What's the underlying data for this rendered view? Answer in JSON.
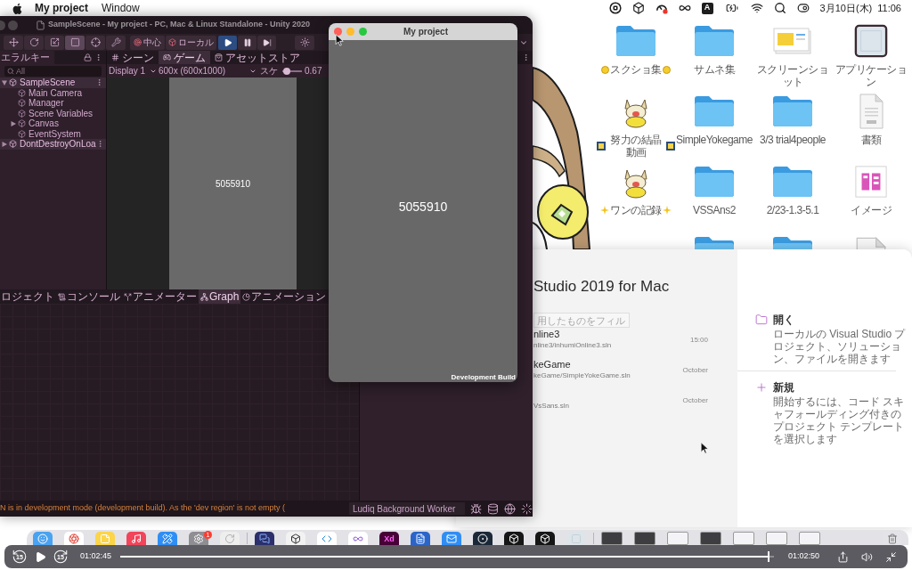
{
  "menubar": {
    "app_name": "My project",
    "menus": [
      "Window"
    ],
    "input_source": "A",
    "date": "3月10日(木)",
    "time": "11:06"
  },
  "desktop_icons": [
    {
      "kind": "folder",
      "label": "スクショ集",
      "decoration": {
        "kind": "coin"
      }
    },
    {
      "kind": "folder",
      "label": "サムネ集"
    },
    {
      "kind": "screenshot",
      "label": "スクリーンショット"
    },
    {
      "kind": "app_folder",
      "label": "アプリケーション"
    },
    {
      "kind": "sticker",
      "label": "努力の結晶動画",
      "decoration": {
        "kind": "picture"
      }
    },
    {
      "kind": "folder",
      "label": "SimpleYokegame"
    },
    {
      "kind": "folder",
      "label": "3/3 trial4people"
    },
    {
      "kind": "document",
      "label": "書類"
    },
    {
      "kind": "sticker",
      "label": "ワンの記録",
      "decoration": {
        "kind": "sparkle"
      }
    },
    {
      "kind": "folder",
      "label": "VSSAns2"
    },
    {
      "kind": "folder",
      "label": "2/23-1.3-5.1"
    },
    {
      "kind": "image",
      "label": "イメージ"
    },
    {
      "kind": "folder"
    },
    {
      "kind": "folder"
    },
    {
      "kind": "document"
    }
  ],
  "unity": {
    "title": "SampleScene - My project - PC, Mac & Linux Standalone - Unity 2020",
    "tools": [
      {
        "kind": "move",
        "selected": false
      },
      {
        "kind": "rotate",
        "selected": false
      },
      {
        "kind": "scale",
        "selected": false
      },
      {
        "kind": "rect",
        "selected": true
      },
      {
        "kind": "transform",
        "selected": false
      },
      {
        "kind": "custom",
        "selected": false
      }
    ],
    "pivot_button": "中心",
    "space_button": "ローカル",
    "playback": [
      {
        "kind": "play",
        "on": true
      },
      {
        "kind": "pause",
        "on": false
      },
      {
        "kind": "step",
        "on": false
      }
    ],
    "hierarchy": {
      "tab": "エラルキー",
      "search_placeholder": "All",
      "items": [
        {
          "label": "SampleScene",
          "kind": "scene",
          "expanded": true,
          "children": [
            {
              "label": "Main Camera",
              "kind": "object"
            },
            {
              "label": "Manager",
              "kind": "object"
            },
            {
              "label": "Scene Variables",
              "kind": "object"
            },
            {
              "label": "Canvas",
              "kind": "object",
              "expanded": false
            },
            {
              "label": "EventSystem",
              "kind": "object"
            }
          ]
        },
        {
          "label": "DontDestroyOnLoa",
          "kind": "scene",
          "expanded": false
        }
      ]
    },
    "center_tabs": [
      {
        "label": "シーン",
        "kind": "scene",
        "selected": false
      },
      {
        "label": "ゲーム",
        "kind": "game",
        "selected": true
      },
      {
        "label": "アセットストア",
        "kind": "store",
        "selected": false
      }
    ],
    "display": "Display 1",
    "resolution": "600x (600x1000)",
    "scale": {
      "label": "スケ",
      "level": 0.05,
      "reading": "0.67"
    },
    "game_score": "5055910",
    "bottom_tabs": [
      {
        "label": "ロジェクト",
        "kind": "project",
        "selected": false
      },
      {
        "label": "コンソール",
        "kind": "console",
        "selected": false
      },
      {
        "label": "アニメーター",
        "kind": "animator",
        "selected": false
      },
      {
        "label": "Graph",
        "kind": "graph",
        "selected": true
      },
      {
        "label": "アニメーション",
        "kind": "animation",
        "selected": false
      }
    ],
    "status_message": "N is in development mode (development build). As the 'dev region' is not empty (",
    "background_task": "Ludiq Background Worker"
  },
  "player_window": {
    "title": "My project",
    "score": "5055910",
    "build_label": "Development Build"
  },
  "visual_studio": {
    "title": "Studio 2019 for Mac",
    "filter_placeholder": "用したものをフィル",
    "recent": [
      {
        "name": "nline3",
        "path": "nline3/inhumiOnline3.sln",
        "time": "15:00"
      },
      {
        "name": "keGame",
        "path": "keGame/SimpleYokeGame.sln",
        "time": "October"
      },
      {
        "path": "VsSans.sln",
        "time": "October"
      }
    ],
    "actions": [
      {
        "kind": "open",
        "title": "開く",
        "description": "ローカルの Visual Studio プロジェクト、ソリューション、ファイルを開きます"
      },
      {
        "kind": "new",
        "title": "新規",
        "description": "開始するには、コード スキャフォールディング付きのプロジェクト テンプレートを選択します"
      }
    ]
  },
  "dock": {
    "sections": [
      [
        {
          "kind": "finder"
        },
        {
          "kind": "browser"
        },
        {
          "kind": "notes"
        },
        {
          "kind": "music"
        },
        {
          "kind": "store"
        },
        {
          "kind": "settings",
          "badge": "1"
        },
        {
          "kind": "loader"
        }
      ],
      [
        {
          "kind": "chat"
        },
        {
          "kind": "cube"
        },
        {
          "kind": "code"
        },
        {
          "kind": "ide"
        },
        {
          "kind": "design",
          "glyph": "Xd"
        },
        {
          "kind": "doc"
        },
        {
          "kind": "mail"
        },
        {
          "kind": "game"
        },
        {
          "kind": "unity"
        },
        {
          "kind": "unity"
        },
        {
          "kind": "blank"
        }
      ],
      [
        {
          "kind": "thumb_dark"
        },
        {
          "kind": "thumb_dark"
        },
        {
          "kind": "thumb_light"
        },
        {
          "kind": "thumb_dark"
        },
        {
          "kind": "thumb_light"
        },
        {
          "kind": "thumb_light"
        },
        {
          "kind": "thumb_light"
        },
        {
          "kind": "trash"
        }
      ]
    ]
  },
  "video_controls": {
    "skip_back": "15",
    "skip_forward": "15",
    "current_time": "01:02:45",
    "end_time": "01:02:50",
    "level": 0.99
  }
}
